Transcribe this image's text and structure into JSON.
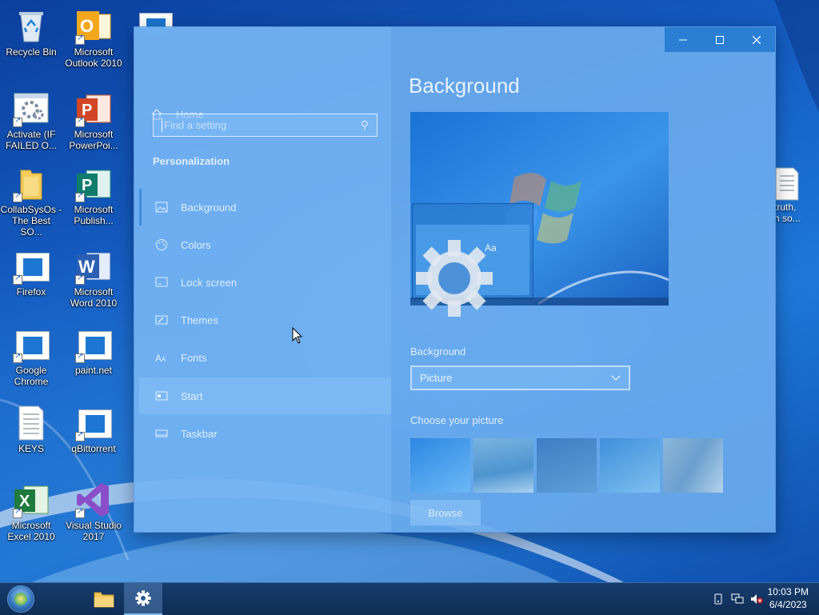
{
  "desktop": {
    "icons": [
      {
        "label": "Recycle Bin",
        "icon": "recycle-bin-icon"
      },
      {
        "label": "Microsoft Outlook 2010",
        "icon": "outlook-icon"
      },
      {
        "label": "Activate (IF FAILED O...",
        "icon": "activate-icon"
      },
      {
        "label": "Microsoft PowerPoi...",
        "icon": "powerpoint-icon"
      },
      {
        "label": "CollabSysOs - The Best SO...",
        "icon": "folder-icon"
      },
      {
        "label": "Microsoft Publish...",
        "icon": "publisher-icon"
      },
      {
        "label": "Firefox",
        "icon": "firefox-icon"
      },
      {
        "label": "Microsoft Word 2010",
        "icon": "word-icon"
      },
      {
        "label": "Google Chrome",
        "icon": "chrome-icon"
      },
      {
        "label": "paint.net",
        "icon": "paintnet-icon"
      },
      {
        "label": "KEYS",
        "icon": "text-file-icon"
      },
      {
        "label": "qBittorrent",
        "icon": "qbittorrent-icon"
      },
      {
        "label": "Microsoft Excel 2010",
        "icon": "excel-icon"
      },
      {
        "label": "Visual Studio 2017",
        "icon": "visual-studio-icon"
      }
    ],
    "partial_icon": {
      "line1": "truth,",
      "line2": "n so..."
    }
  },
  "settings": {
    "nav": {
      "home": "Home",
      "search_placeholder": "Find a setting",
      "section": "Personalization",
      "items": [
        {
          "label": "Background",
          "icon": "picture-icon"
        },
        {
          "label": "Colors",
          "icon": "palette-icon"
        },
        {
          "label": "Lock screen",
          "icon": "lock-screen-icon"
        },
        {
          "label": "Themes",
          "icon": "themes-icon"
        },
        {
          "label": "Fonts",
          "icon": "fonts-icon"
        },
        {
          "label": "Start",
          "icon": "start-icon"
        },
        {
          "label": "Taskbar",
          "icon": "taskbar-icon"
        }
      ]
    },
    "content": {
      "title": "Background",
      "preview_sample": "Aa",
      "background_label": "Background",
      "background_value": "Picture",
      "choose_label": "Choose your picture",
      "browse": "Browse"
    },
    "titlebar": {
      "minimize": "—",
      "maximize": "☐",
      "close": "✕"
    }
  },
  "taskbar": {
    "clock_time": "10:03 PM",
    "clock_date": "6/4/2023"
  },
  "colors": {
    "accent": "#2a7fd5",
    "taskbar": "#0e2d55"
  }
}
